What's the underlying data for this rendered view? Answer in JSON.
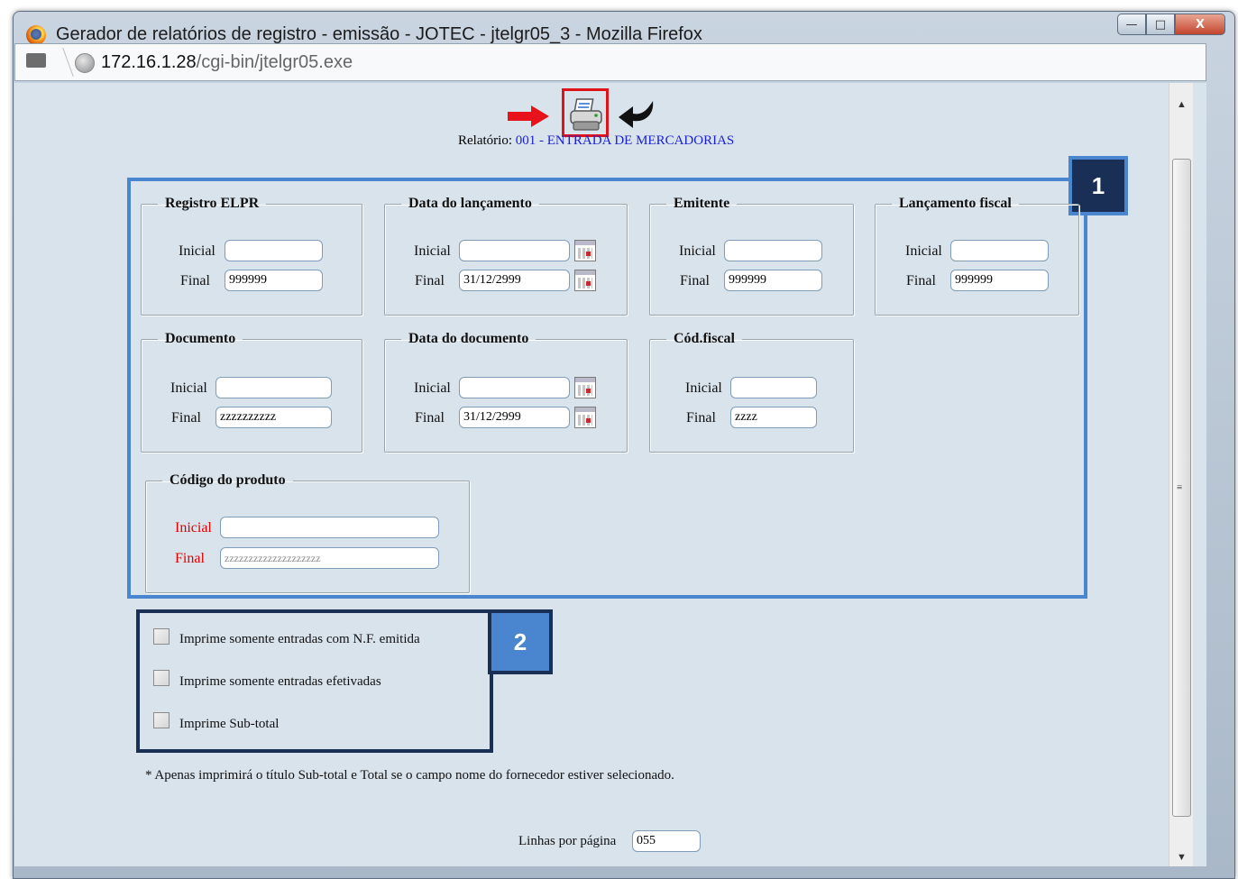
{
  "window": {
    "title": "Gerador de relatórios de registro - emissão - JOTEC - jtelgr05_3 - Mozilla Firefox",
    "minimize": "—",
    "maximize": "□",
    "close": "X"
  },
  "address_bar": {
    "host": "172.16.1.28",
    "path": "/cgi-bin/jtelgr05.exe"
  },
  "toolbar": {
    "icons": [
      "arrow-right-icon",
      "printer-icon",
      "return-icon"
    ]
  },
  "report": {
    "label": "Relatório:",
    "value": "001 - ENTRADA DE MERCADORIAS"
  },
  "callouts": {
    "one": "1",
    "two": "2"
  },
  "groups": {
    "registro_elpr": {
      "legend": "Registro ELPR",
      "inicial_label": "Inicial",
      "final_label": "Final",
      "inicial_value": "",
      "final_value": "999999"
    },
    "data_lancamento": {
      "legend": "Data do lançamento",
      "inicial_label": "Inicial",
      "final_label": "Final",
      "inicial_value": "",
      "final_value": "31/12/2999"
    },
    "emitente": {
      "legend": "Emitente",
      "inicial_label": "Inicial",
      "final_label": "Final",
      "inicial_value": "",
      "final_value": "999999"
    },
    "lancamento_fiscal": {
      "legend": "Lançamento fiscal",
      "inicial_label": "Inicial",
      "final_label": "Final",
      "inicial_value": "",
      "final_value": "999999"
    },
    "documento": {
      "legend": "Documento",
      "inicial_label": "Inicial",
      "final_label": "Final",
      "inicial_value": "",
      "final_value": "zzzzzzzzzz"
    },
    "data_documento": {
      "legend": "Data do documento",
      "inicial_label": "Inicial",
      "final_label": "Final",
      "inicial_value": "",
      "final_value": "31/12/2999"
    },
    "cod_fiscal": {
      "legend": "Cód.fiscal",
      "inicial_label": "Inicial",
      "final_label": "Final",
      "inicial_value": "",
      "final_value": "zzzz"
    },
    "codigo_produto": {
      "legend": "Código do produto",
      "inicial_label": "Inicial",
      "final_label": "Final",
      "inicial_value": "",
      "final_value": "zzzzzzzzzzzzzzzzzzzz"
    }
  },
  "options": {
    "nf_emitida": {
      "label": "Imprime somente entradas com N.F. emitida",
      "checked": false
    },
    "efetivadas": {
      "label": "Imprime somente entradas efetivadas",
      "checked": false
    },
    "sub_total": {
      "label": "Imprime Sub-total",
      "checked": false
    }
  },
  "note": "* Apenas imprimirá o título Sub-total e Total se o campo nome do fornecedor estiver selecionado.",
  "lines_per_page": {
    "label": "Linhas por página",
    "value": "055"
  },
  "colors": {
    "callout_blue": "#4a86d0",
    "callout_dark": "#1a2f55",
    "highlight_red": "#e0131a",
    "link_blue": "#1b21d6"
  }
}
